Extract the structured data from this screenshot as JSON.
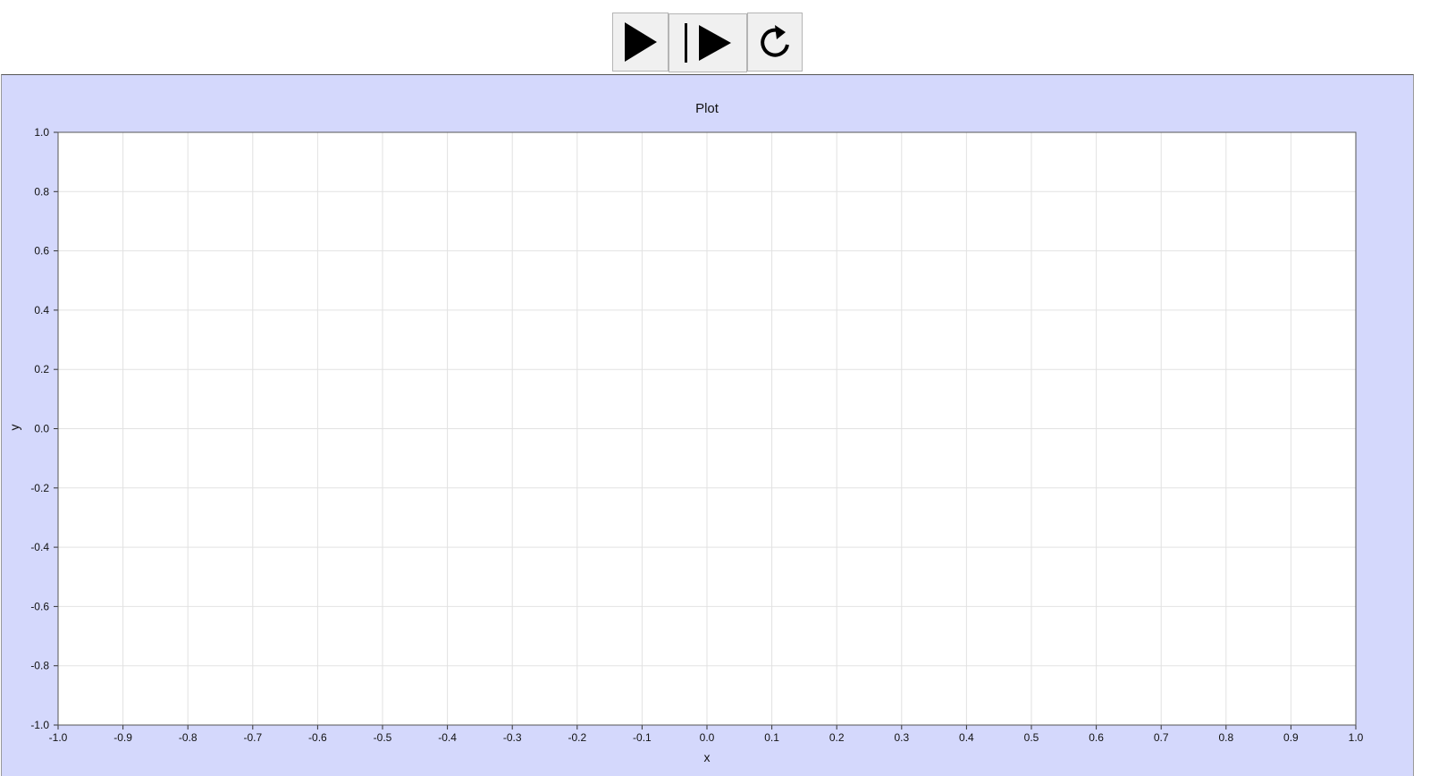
{
  "toolbar": {
    "play_icon": "play-icon",
    "step_icon": "step-forward-icon",
    "reset_icon": "reset-icon"
  },
  "chart_data": {
    "type": "scatter",
    "title": "Plot",
    "xlabel": "x",
    "ylabel": "y",
    "xlim": [
      -1.0,
      1.0
    ],
    "ylim": [
      -1.0,
      1.0
    ],
    "grid": true,
    "x_ticks": [
      "-1.0",
      "-0.9",
      "-0.8",
      "-0.7",
      "-0.6",
      "-0.5",
      "-0.4",
      "-0.3",
      "-0.2",
      "-0.1",
      "0.0",
      "0.1",
      "0.2",
      "0.3",
      "0.4",
      "0.5",
      "0.6",
      "0.7",
      "0.8",
      "0.9",
      "1.0"
    ],
    "y_ticks": [
      "1.0",
      "0.8",
      "0.6",
      "0.4",
      "0.2",
      "0.0",
      "-0.2",
      "-0.4",
      "-0.6",
      "-0.8",
      "-1.0"
    ],
    "series": []
  },
  "colors": {
    "panel_background": "#d4d8fc",
    "plot_background": "#ffffff",
    "grid": "#e2e2e2",
    "button_background": "#f0f0f0"
  }
}
